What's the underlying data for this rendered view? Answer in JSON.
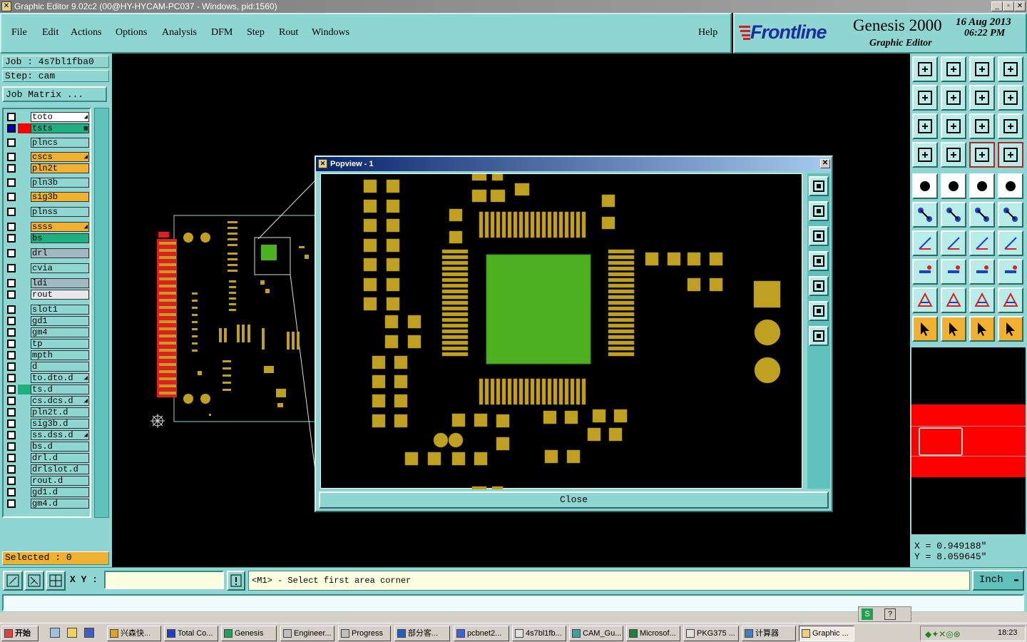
{
  "window": {
    "title": "Graphic Editor 9.02c2 (00@HY-HYCAM-PC037 - Windows, pid:1560)"
  },
  "menu": {
    "file": "File",
    "edit": "Edit",
    "actions": "Actions",
    "options": "Options",
    "analysis": "Analysis",
    "dfm": "DFM",
    "step": "Step",
    "rout": "Rout",
    "windows": "Windows",
    "help": "Help"
  },
  "brand": {
    "logo": "Frontline",
    "product": "Genesis 2000",
    "subtitle": "Graphic Editor",
    "date": "16 Aug 2013",
    "time": "06:22 PM"
  },
  "job": {
    "job_label": "Job : 4s7bl1fba0",
    "step_label": "Step: cam",
    "matrix_button": "Job Matrix ..."
  },
  "layers": [
    {
      "name": "to",
      "color": "#ffffff",
      "swatch": "",
      "mark": "◢"
    },
    {
      "name": "ts",
      "color": "#20b080",
      "swatch": "#ff0000",
      "mark": "▦",
      "selected": true
    },
    {
      "name": "plncs",
      "color": "#8fd6d2",
      "swatch": "",
      "mark": ""
    },
    {
      "name": "cs",
      "color": "#f0b030",
      "swatch": "",
      "mark": "◢"
    },
    {
      "name": "pln2t",
      "color": "#f0b030",
      "swatch": "",
      "mark": ""
    },
    {
      "name": "pln3b",
      "color": "#8fd6d2",
      "swatch": "",
      "mark": ""
    },
    {
      "name": "sig3b",
      "color": "#f0b030",
      "swatch": "",
      "mark": ""
    },
    {
      "name": "plnss",
      "color": "#8fd6d2",
      "swatch": "",
      "mark": ""
    },
    {
      "name": "ss",
      "color": "#f0b030",
      "swatch": "",
      "mark": "◢"
    },
    {
      "name": "bs",
      "color": "#20b080",
      "swatch": "",
      "mark": ""
    },
    {
      "name": "drl",
      "color": "#a0b8c0",
      "swatch": "",
      "mark": ""
    },
    {
      "name": "cvia",
      "color": "#8fd6d2",
      "swatch": "",
      "mark": ""
    },
    {
      "name": "ldi",
      "color": "#a0b8c0",
      "swatch": "",
      "mark": ""
    },
    {
      "name": "rout",
      "color": "#e8e8e8",
      "swatch": "",
      "mark": ""
    },
    {
      "name": "slot1",
      "color": "#8fd6d2",
      "swatch": "",
      "mark": ""
    },
    {
      "name": "gd1",
      "color": "#8fd6d2",
      "swatch": "",
      "mark": ""
    },
    {
      "name": "gm4",
      "color": "#8fd6d2",
      "swatch": "",
      "mark": ""
    },
    {
      "name": "tp",
      "color": "#8fd6d2",
      "swatch": "",
      "mark": ""
    },
    {
      "name": "mpth",
      "color": "#8fd6d2",
      "swatch": "",
      "mark": ""
    },
    {
      "name": "d",
      "color": "#8fd6d2",
      "swatch": "",
      "mark": ""
    },
    {
      "name": "to.d",
      "color": "#8fd6d2",
      "swatch": "",
      "mark": "◢"
    },
    {
      "name": "ts.d",
      "color": "#8fd6d2",
      "swatch": "#20b080",
      "mark": ""
    },
    {
      "name": "cs.d",
      "color": "#8fd6d2",
      "swatch": "",
      "mark": "◢"
    },
    {
      "name": "pln2t.d",
      "color": "#8fd6d2",
      "swatch": "",
      "mark": ""
    },
    {
      "name": "sig3b.d",
      "color": "#8fd6d2",
      "swatch": "",
      "mark": ""
    },
    {
      "name": "ss.d",
      "color": "#8fd6d2",
      "swatch": "",
      "mark": "◢"
    },
    {
      "name": "bs.d",
      "color": "#8fd6d2",
      "swatch": "",
      "mark": ""
    },
    {
      "name": "drl.d",
      "color": "#8fd6d2",
      "swatch": "",
      "mark": ""
    },
    {
      "name": "drlslot.d",
      "color": "#8fd6d2",
      "swatch": "",
      "mark": ""
    },
    {
      "name": "rout.d",
      "color": "#8fd6d2",
      "swatch": "",
      "mark": ""
    },
    {
      "name": "gd1.d",
      "color": "#8fd6d2",
      "swatch": "",
      "mark": ""
    },
    {
      "name": "gm4.d",
      "color": "#8fd6d2",
      "swatch": "",
      "mark": ""
    }
  ],
  "selected": {
    "label": "Selected : 0"
  },
  "coords": {
    "x": "X = 0.949188\"",
    "y": "Y = 8.059645\""
  },
  "bottom": {
    "xy_label": "X Y :",
    "xy_value": "",
    "prompt": "<M1> - Select first area corner",
    "units": "Inch"
  },
  "popview": {
    "title": "Popview - 1",
    "close_label": "Close"
  },
  "colors": {
    "pad": "#c0a020",
    "copper": "#4cb020",
    "teal": "#8fd6d2",
    "red": "#ff0000"
  },
  "taskbar": {
    "start": "开始",
    "tasks": [
      "兴森快...",
      "Total Co...",
      "Genesis",
      "Engineer...",
      "Progress",
      "部分客...",
      "pcbnet2...",
      "4s7bl1fb...",
      "CAM_Gu...",
      "Microsof...",
      "PKG375 ...",
      "计算器",
      "Graphic ..."
    ],
    "clock": "18:23"
  }
}
